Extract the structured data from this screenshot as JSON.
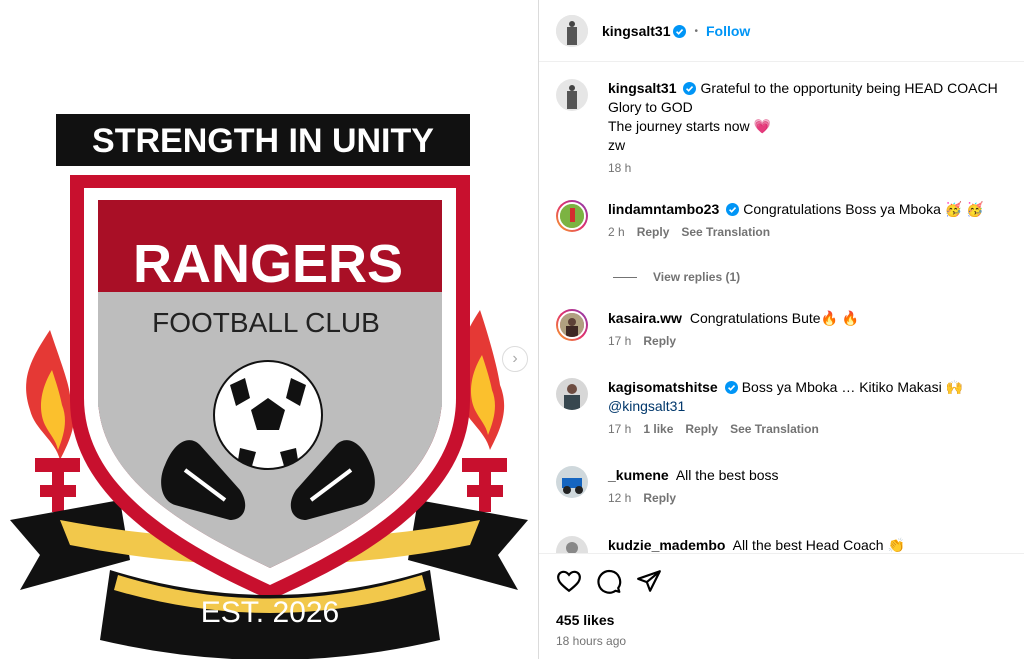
{
  "image": {
    "banner_text": "STRENGTH IN UNITY",
    "club_name": "RANGERS",
    "club_sub": "FOOTBALL CLUB",
    "est": "EST. 2026",
    "next_arrow_icon": "chevron-right-icon"
  },
  "header": {
    "username": "kingsalt31",
    "follow_label": "Follow",
    "separator": "•"
  },
  "caption": {
    "username": "kingsalt31",
    "lines": [
      "Grateful to the opportunity being HEAD COACH",
      "Glory to GOD",
      "The journey starts now 💗",
      "zw"
    ],
    "time": "18 h"
  },
  "comments": [
    {
      "username": "lindamntambo23",
      "verified": true,
      "text": "Congratulations Boss ya Mboka 🥳 🥳",
      "time": "2 h",
      "likes": "",
      "reply": "Reply",
      "translate": "See Translation"
    },
    {
      "username": "kasaira.ww",
      "verified": false,
      "text": "Congratulations Bute🔥 🔥",
      "time": "17 h",
      "likes": "",
      "reply": "Reply",
      "translate": ""
    },
    {
      "username": "kagisomatshitse",
      "verified": true,
      "text": "Boss ya Mboka … Kitiko Makasi 🙌",
      "mention": "@kingsalt31",
      "time": "17 h",
      "likes": "1 like",
      "reply": "Reply",
      "translate": "See Translation"
    },
    {
      "username": "_kumene",
      "verified": false,
      "text": "All the best boss",
      "time": "12 h",
      "likes": "",
      "reply": "Reply",
      "translate": ""
    },
    {
      "username": "kudzie_madembo",
      "verified": false,
      "text": "All the best Head Coach 👏",
      "time": "",
      "likes": "",
      "reply": "",
      "translate": ""
    }
  ],
  "view_replies": "View replies (1)",
  "footer": {
    "likes": "455 likes",
    "time_ago": "18 hours ago",
    "icons": [
      "heart-icon",
      "comment-icon",
      "share-icon"
    ]
  },
  "colors": {
    "link_blue": "#0095f6",
    "verified_blue": "#0095f6",
    "crest_red": "#c8102e",
    "muted_text": "#737373"
  }
}
